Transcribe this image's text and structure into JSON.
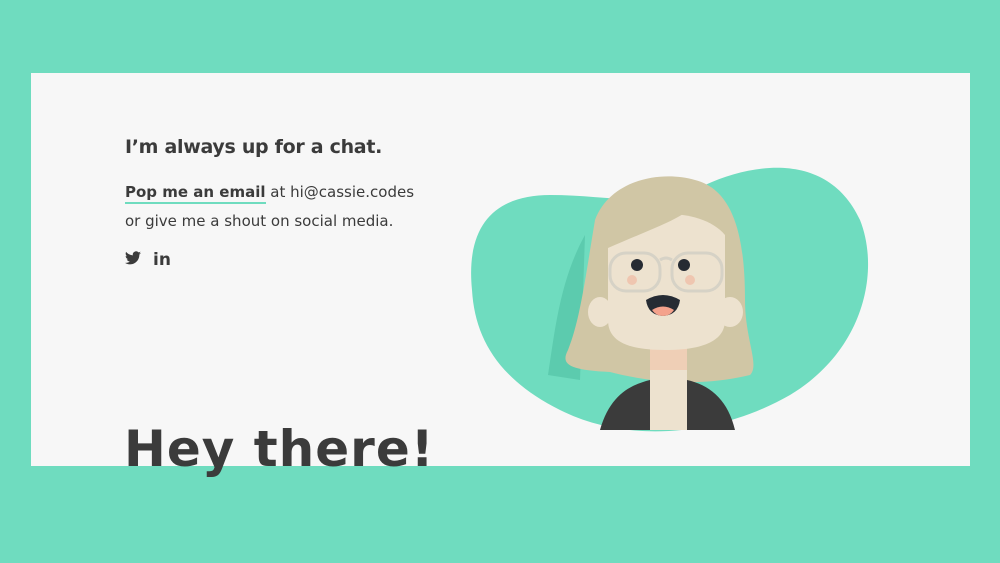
{
  "contact": {
    "heading": "I’m always up for a chat.",
    "email_link": "Pop me an email",
    "email_text": " at hi@cassie.codes",
    "line2": "or give me a shout on social media.",
    "social": [
      {
        "icon": "twitter-icon"
      },
      {
        "icon": "linkedin-icon",
        "label": "in"
      }
    ]
  },
  "hero": {
    "title": "Hey there!"
  },
  "colors": {
    "accent": "#6fdcbf",
    "card": "#f7f7f7",
    "text": "#3b3b3b",
    "hair": "#d0c6a5",
    "skin": "#ede2cf"
  }
}
